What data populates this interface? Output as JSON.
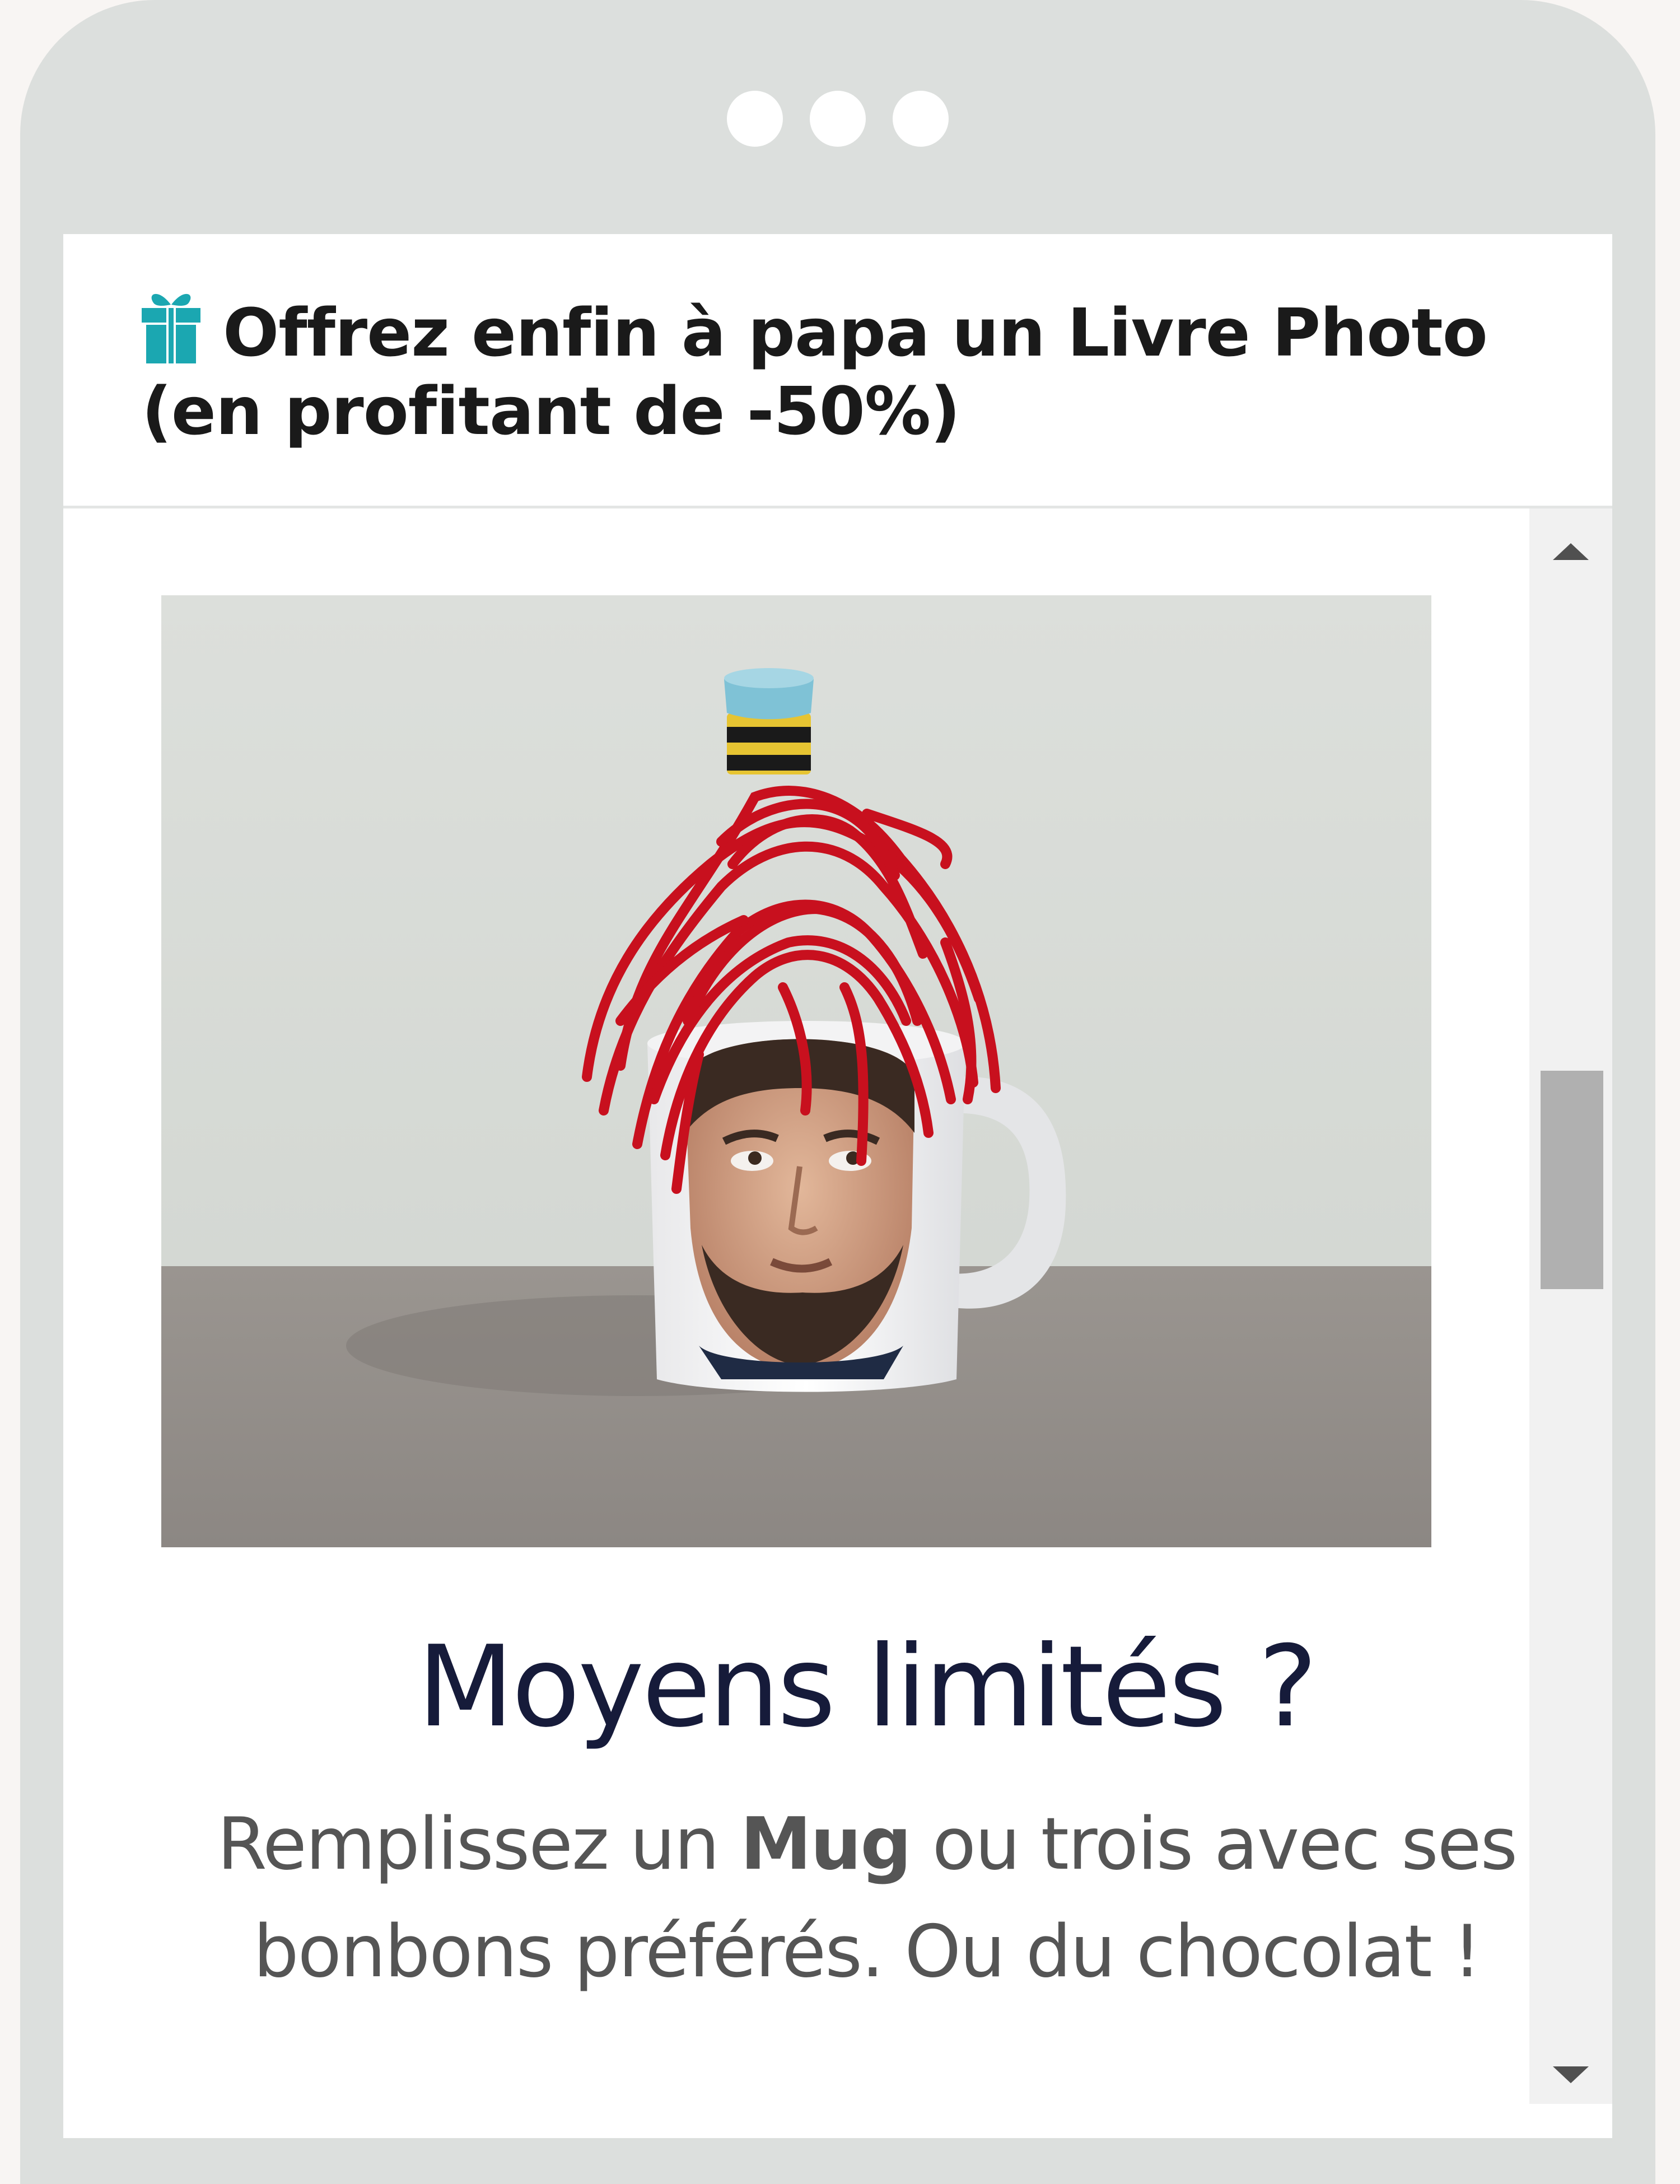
{
  "window": {
    "chrome_dots": 3
  },
  "email": {
    "subject": "Offrez enfin à papa un Livre Photo (en profitant de -50%)",
    "subject_icon": "gift-icon",
    "accent_color": "#1ba7b1"
  },
  "content": {
    "hero_image_description": "mug-with-candy-hair",
    "heading": "Moyens limités ?",
    "paragraph_before": "Remplissez un ",
    "paragraph_bold": "Mug",
    "paragraph_after": " ou trois avec ses bonbons préférés. Ou du chocolat !"
  },
  "scrollbar": {
    "position_fraction": 0.35
  }
}
